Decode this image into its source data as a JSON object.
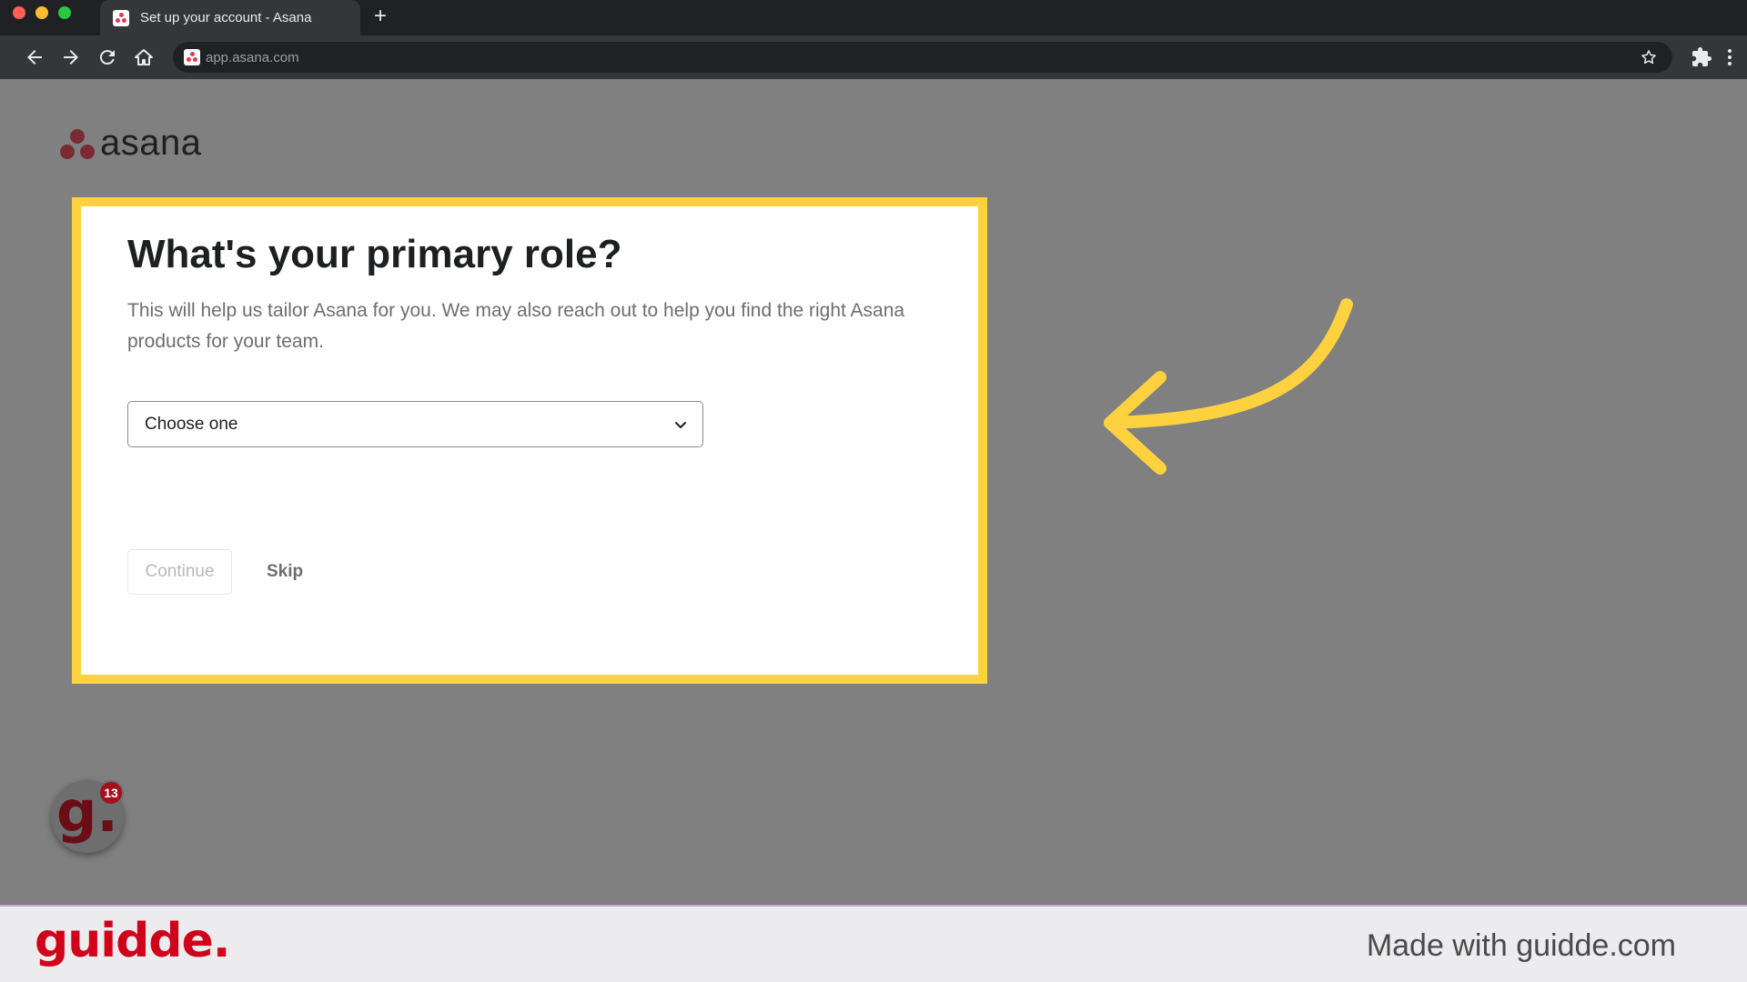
{
  "browser": {
    "tab_title": "Set up your account - Asana",
    "new_tab": "+",
    "url": "app.asana.com"
  },
  "page": {
    "logo_text": "asana",
    "heading": "What's your primary role?",
    "description": "This will help us tailor Asana for you. We may also reach out to help you find the right Asana products for your team.",
    "select": {
      "value": "Choose one"
    },
    "continue_label": "Continue",
    "skip_label": "Skip"
  },
  "annotation": {
    "highlight_color": "#fdd23e",
    "arrow_color": "#fdd23e"
  },
  "guidde_badge": {
    "letter": "g.",
    "count": "13"
  },
  "footer": {
    "brand": "guidde.",
    "made_with": "Made with guidde.com"
  },
  "colors": {
    "asana_red": "#e8384f",
    "guidde_red": "#d0021b"
  }
}
